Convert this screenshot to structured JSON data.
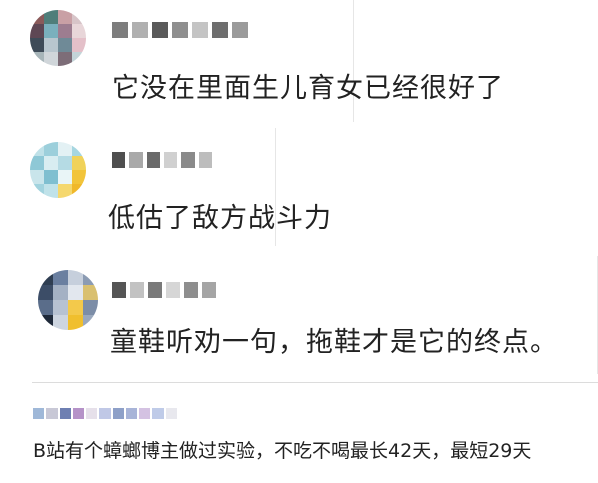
{
  "comments": [
    {
      "text": "它没在里面生儿育女已经很好了",
      "avatar_palette": [
        "#8a5a5a",
        "#4f7e7a",
        "#c9a0a5",
        "#d7c4c8",
        "#5e4754",
        "#7ab0bd",
        "#9d7d90",
        "#e8d6d9",
        "#3e4b58",
        "#b8c6ce",
        "#6f8a97",
        "#e4c0c9",
        "#a7b5b9",
        "#d0d6da",
        "#7d6d78",
        "#c3d4d8"
      ],
      "name_mosaic": [
        "#7d7d7d",
        "#b0b0b0",
        "#5a5a5a",
        "#8f8f8f",
        "#c4c4c4",
        "#6e6e6e",
        "#9b9b9b"
      ]
    },
    {
      "text": "低估了敌方战斗力",
      "avatar_palette": [
        "#bfe1e8",
        "#9ccfdb",
        "#e3f1f4",
        "#a6d6e0",
        "#8ec8d6",
        "#d8edf1",
        "#b5dbe4",
        "#f0d25a",
        "#c9e5eb",
        "#7fbfd0",
        "#e9f5f7",
        "#f2c43a",
        "#a2d3de",
        "#c0e2e9",
        "#f5d86e",
        "#f0b82b"
      ],
      "name_mosaic": [
        "#4f4f4f",
        "#a9a9a9",
        "#6a6a6a",
        "#d0d0d0",
        "#8a8a8a",
        "#bdbdbd"
      ]
    },
    {
      "text": "童鞋听劝一句，拖鞋才是它的终点。",
      "avatar_palette": [
        "#2f3e52",
        "#6a7fa0",
        "#c6cfdc",
        "#8b9bb3",
        "#3c4d67",
        "#a4b1c4",
        "#e2e7ee",
        "#d9c070",
        "#5a6d8a",
        "#b7c2d2",
        "#f3c94b",
        "#7c8da7",
        "#1f2a3a",
        "#cdd5e0",
        "#f0bf2e",
        "#9aa8bd"
      ],
      "name_mosaic": [
        "#555555",
        "#c2c2c2",
        "#7a7a7a",
        "#d6d6d6",
        "#8e8e8e",
        "#a5a5a5"
      ]
    }
  ],
  "bottom_comment": {
    "text": "B站有个蟑螂博主做过实验，不吃不喝最长42天，最短29天",
    "name_mosaic": [
      "#9fb8d8",
      "#c8c8d6",
      "#6e7fb2",
      "#b592c8",
      "#e6e0ea",
      "#c0c8e6",
      "#8ea0c8",
      "#a8b4d8",
      "#d4c2e2",
      "#bfcbe8",
      "#e8e8ee"
    ]
  }
}
